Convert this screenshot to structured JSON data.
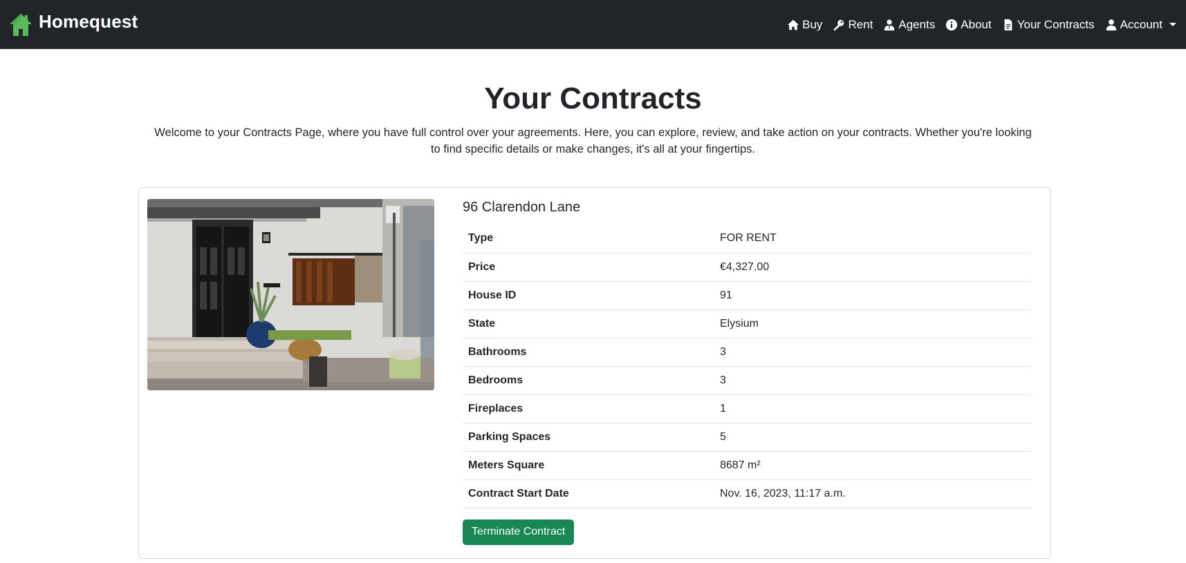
{
  "brand": {
    "name": "Homequest",
    "icon": "house-icon",
    "icon_color": "#5cb85c"
  },
  "nav": {
    "items": [
      {
        "label": "Buy",
        "icon": "home-icon"
      },
      {
        "label": "Rent",
        "icon": "key-icon"
      },
      {
        "label": "Agents",
        "icon": "agent-icon"
      },
      {
        "label": "About",
        "icon": "info-icon"
      },
      {
        "label": "Your Contracts",
        "icon": "document-icon"
      },
      {
        "label": "Account",
        "icon": "user-icon"
      }
    ]
  },
  "page": {
    "title": "Your Contracts",
    "intro": "Welcome to your Contracts Page, where you have full control over your agreements. Here, you can explore, review, and take action on your contracts. Whether you're looking to find specific details or make changes, it's all at your fingertips."
  },
  "contract": {
    "address": "96 Clarendon Lane",
    "rows": [
      {
        "label": "Type",
        "value": "FOR RENT"
      },
      {
        "label": "Price",
        "value": "€4,327.00"
      },
      {
        "label": "House ID",
        "value": "91"
      },
      {
        "label": "State",
        "value": "Elysium"
      },
      {
        "label": "Bathrooms",
        "value": "3"
      },
      {
        "label": "Bedrooms",
        "value": "3"
      },
      {
        "label": "Fireplaces",
        "value": "1"
      },
      {
        "label": "Parking Spaces",
        "value": "5"
      },
      {
        "label": "Meters Square",
        "value": "8687 m²"
      },
      {
        "label": "Contract Start Date",
        "value": "Nov. 16, 2023, 11:17 a.m."
      }
    ],
    "terminate_label": "Terminate Contract"
  },
  "colors": {
    "navbar": "#212529",
    "button": "#198754",
    "brand_icon": "#5cb85c"
  }
}
